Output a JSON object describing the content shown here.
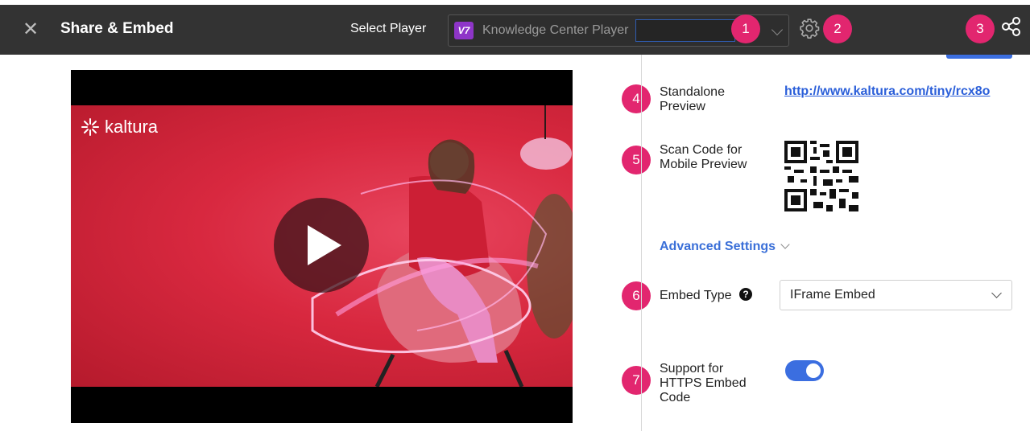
{
  "header": {
    "close_icon": "close-icon",
    "title": "Share & Embed",
    "select_player_label": "Select Player",
    "player_badge": "V7",
    "player_name": "Knowledge Center Player",
    "settings_icon": "gear-icon",
    "share_icon": "share-icon"
  },
  "callouts": [
    "1",
    "2",
    "3",
    "4",
    "5",
    "6",
    "7"
  ],
  "video": {
    "logo_text": "kaltura",
    "play_icon": "play-icon"
  },
  "preview": {
    "standalone_label": "Standalone Preview",
    "standalone_url": "http://www.kaltura.com/tiny/rcx8o",
    "scan_label": "Scan Code for Mobile Preview"
  },
  "advanced": {
    "label": "Advanced Settings"
  },
  "embed": {
    "type_label": "Embed Type",
    "type_value": "IFrame Embed",
    "https_label": "Support for HTTPS Embed Code",
    "https_enabled": true
  },
  "colors": {
    "accent": "#3b6ee0",
    "callout": "#e2266f",
    "topbar": "#333333"
  }
}
